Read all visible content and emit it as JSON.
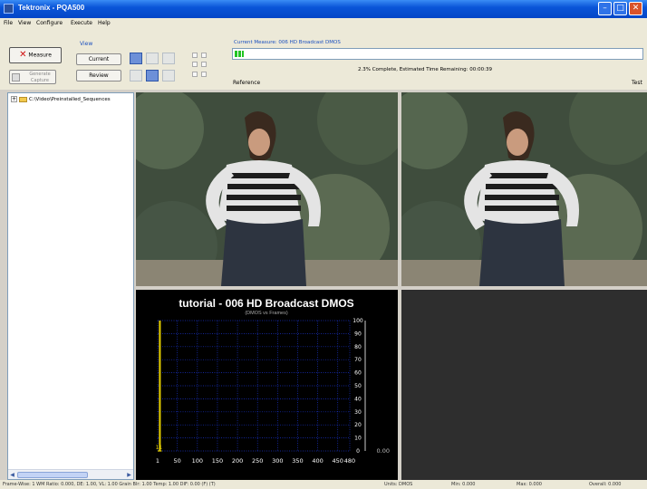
{
  "window": {
    "title": "Tektronix - PQA500"
  },
  "menu": [
    "File",
    "View",
    "Configure",
    "Execute",
    "Help"
  ],
  "toolbar": {
    "measure_label": "Measure",
    "generate_label": "Generate Capture",
    "view_label": "View",
    "current_label": "Current",
    "review_label": "Review"
  },
  "progress": {
    "measure_title": "Current Measure: 006 HD Broadcast DMOS",
    "fraction": 0.023,
    "status": "2.3% Complete, Estimated Time Remaining: 00:00:39",
    "reference_label": "Reference",
    "test_label": "Test"
  },
  "tree": {
    "root_label": "C:\\Video\\Preinstalled_Sequences"
  },
  "chart_data": {
    "type": "line",
    "title": "tutorial - 006 HD Broadcast DMOS",
    "subtitle": "(DMOS vs Frames)",
    "x_ticks": [
      "1",
      "50",
      "100",
      "150",
      "200",
      "250",
      "300",
      "350",
      "400",
      "450",
      "480"
    ],
    "y_ticks": [
      "0",
      "10",
      "20",
      "30",
      "40",
      "50",
      "60",
      "70",
      "80",
      "90",
      "100"
    ],
    "xlim": [
      1,
      480
    ],
    "ylim": [
      0,
      100
    ],
    "series": [
      {
        "x": [
          1,
          11
        ],
        "y": [
          0,
          0
        ]
      }
    ],
    "marker_label": "11",
    "current_value": "0.00",
    "grid": true,
    "colors": {
      "background": "#000000",
      "grid": "#1a33cc",
      "marker": "#e8d200",
      "text": "#ffffff"
    }
  },
  "status": {
    "left": "Frame-Wise: 1 WM Ratio: 0.000, DE: 1.00, VL: 1.00 Grain Blr: 1.00 Temp: 1.00 DIF: 0.00 (F) (T)",
    "units": "Units: DMOS",
    "min": "Min: 0.000",
    "max": "Max: 0.000",
    "overall": "Overall: 0.000"
  }
}
